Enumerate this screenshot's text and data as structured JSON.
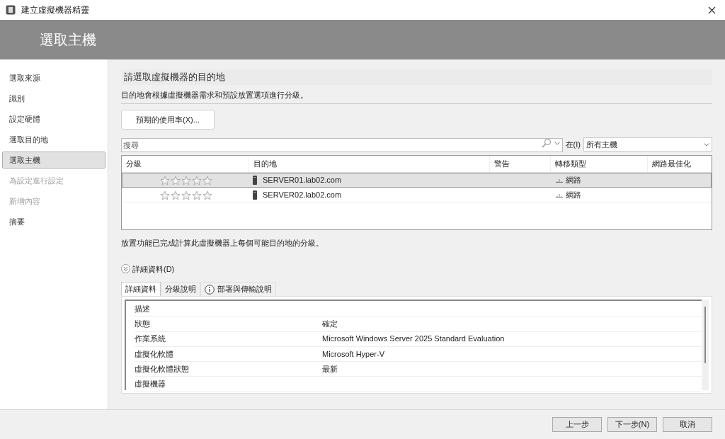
{
  "window": {
    "title": "建立虛擬機器精靈"
  },
  "header": {
    "title": "選取主機"
  },
  "sidebar": {
    "items": [
      {
        "label": "選取來源",
        "selected": false,
        "disabled": false
      },
      {
        "label": "識別",
        "selected": false,
        "disabled": false
      },
      {
        "label": "設定硬體",
        "selected": false,
        "disabled": false
      },
      {
        "label": "選取目的地",
        "selected": false,
        "disabled": false
      },
      {
        "label": "選取主機",
        "selected": true,
        "disabled": false
      },
      {
        "label": "為設定進行設定",
        "selected": false,
        "disabled": true
      },
      {
        "label": "新增內容",
        "selected": false,
        "disabled": true
      },
      {
        "label": "摘要",
        "selected": false,
        "disabled": false
      }
    ]
  },
  "heading": "請選取虛擬機器的目的地",
  "description": "目的地會根據虛擬機器需求和預設放置選項進行分級。",
  "usage_button": "預期的使用率(X)...",
  "search": {
    "placeholder": "搜尋",
    "in_label": "在(I)",
    "scope": "所有主機"
  },
  "table": {
    "columns": [
      "分級",
      "目的地",
      "警告",
      "轉移類型",
      "網路最佳化"
    ],
    "rows": [
      {
        "stars": 0,
        "destination": "SERVER01.lab02.com",
        "transfer": "網路",
        "selected": true
      },
      {
        "stars": 0,
        "destination": "SERVER02.lab02.com",
        "transfer": "網路",
        "selected": false
      }
    ]
  },
  "status_text": "放置功能已完成計算此虛擬機器上每個可能目的地的分級。",
  "details_toggle": {
    "label": "詳細資料(D)",
    "expanded": true
  },
  "tabs": [
    {
      "label": "詳細資料",
      "selected": true,
      "kind": "plain"
    },
    {
      "label": "分級說明",
      "selected": false,
      "kind": "plain"
    },
    {
      "label": "部署與傳輸說明",
      "selected": false,
      "kind": "info"
    }
  ],
  "details": [
    {
      "name": "描述"
    },
    {
      "name": "狀態",
      "value": "確定"
    },
    {
      "name": "作業系統",
      "value": "Microsoft Windows Server 2025 Standard Evaluation"
    },
    {
      "name": "虛擬化軟體",
      "value": "Microsoft Hyper-V"
    },
    {
      "name": "虛擬化軟體狀態",
      "value": "最新"
    },
    {
      "name": "虛擬機器"
    }
  ],
  "buttons": [
    {
      "label": "上一步"
    },
    {
      "label": "下一步(N)"
    },
    {
      "label": "取消"
    }
  ]
}
